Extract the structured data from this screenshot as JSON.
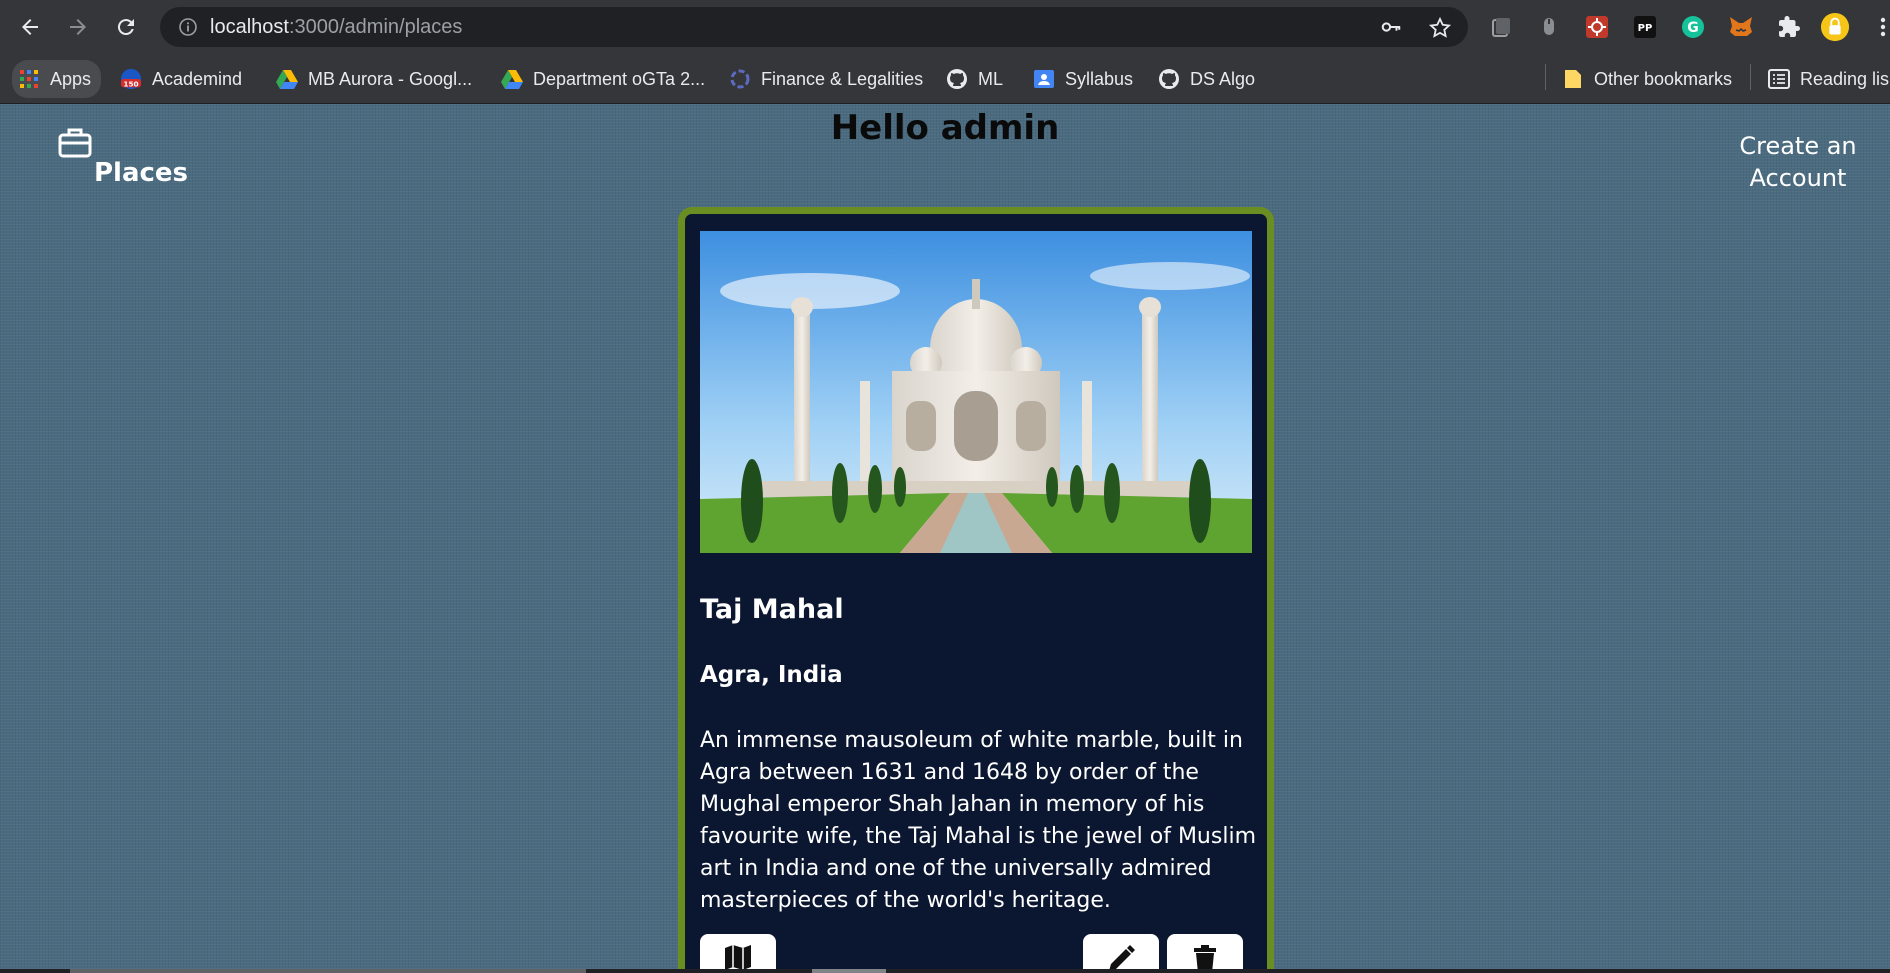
{
  "browser": {
    "url_host": "localhost",
    "url_path": ":3000/admin/places",
    "bookmarks": [
      {
        "label": "Apps",
        "icon": "apps-grid-icon"
      },
      {
        "label": "Academind",
        "icon": "academind-icon"
      },
      {
        "label": "MB Aurora - Googl...",
        "icon": "google-drive-icon"
      },
      {
        "label": "Department oGTa 2...",
        "icon": "google-drive-icon"
      },
      {
        "label": "Finance & Legalities",
        "icon": "loader-icon"
      },
      {
        "label": "ML",
        "icon": "github-icon"
      },
      {
        "label": "Syllabus",
        "icon": "google-classroom-icon"
      },
      {
        "label": "DS Algo",
        "icon": "github-icon"
      }
    ],
    "other_bookmarks": "Other bookmarks",
    "reading_list": "Reading lis",
    "academind_badge": "150"
  },
  "header": {
    "brand": "Places",
    "greeting": "Hello admin",
    "create_account": "Create an Account"
  },
  "place": {
    "name": "Taj Mahal",
    "location": "Agra, India",
    "description": "An immense mausoleum of white marble, built in Agra between 1631 and 1648 by order of the Mughal emperor Shah Jahan in memory of his favourite wife, the Taj Mahal is the jewel of Muslim art in India and one of the universally admired masterpieces of the world's heritage.",
    "image_alt": "Taj Mahal"
  },
  "colors": {
    "page_bg": "#4a6b80",
    "card_bg": "#0b1730",
    "card_border": "#6b8e23",
    "chrome_bg": "#35363a"
  }
}
